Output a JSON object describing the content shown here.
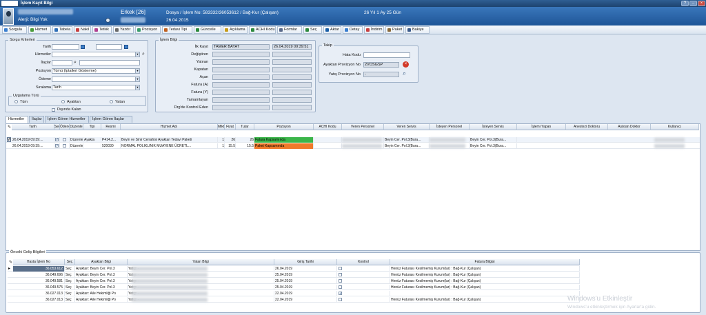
{
  "window": {
    "title": "İşlem Kayıt Bilgi"
  },
  "header": {
    "gender_age": "Erkek [26]",
    "dossier": "Dosya / İşlem No: 583332/36053612 / Bağ-Kur (Çalışan)",
    "duration": "26 Yıl 1 Ay 25 Gün",
    "allergy": "Alerji: Bilgi Yok",
    "date": "26.04.2015"
  },
  "toolbar": [
    {
      "label": "Sorgula",
      "icon": "search-icon",
      "color": "#3a7fd0"
    },
    {
      "label": "Hizmet",
      "icon": "service-icon",
      "color": "#4a9c3a"
    },
    {
      "label": "Tabela",
      "icon": "table-icon",
      "color": "#2f6fb8"
    },
    {
      "label": "Nakil",
      "icon": "transfer-icon",
      "color": "#c84040"
    },
    {
      "label": "Tetkik",
      "icon": "test-icon",
      "color": "#b04090"
    },
    {
      "label": "Yazdır",
      "icon": "print-icon",
      "color": "#6a6a6a"
    },
    {
      "label": "Pozisyon",
      "icon": "position-icon",
      "color": "#3a9c6a"
    },
    {
      "label": "Tedavi Tipi",
      "icon": "treatment-icon",
      "color": "#c06020"
    },
    {
      "label": "Güncelle",
      "icon": "refresh-icon",
      "color": "#2d8a3e"
    },
    {
      "label": "Açıklama",
      "icon": "note-icon",
      "color": "#c79b1a"
    },
    {
      "label": "ACHI Kodu",
      "icon": "code-icon",
      "color": "#2d8a3e"
    },
    {
      "label": "Formlar",
      "icon": "form-icon",
      "color": "#5a6a8a"
    },
    {
      "label": "Seç",
      "icon": "select-icon",
      "color": "#2d8a3e"
    },
    {
      "label": "Aktar",
      "icon": "export-icon",
      "color": "#1a5fa8"
    },
    {
      "label": "Detay",
      "icon": "detail-icon",
      "color": "#3a7fd0"
    },
    {
      "label": "İndirim",
      "icon": "discount-icon",
      "color": "#c84040"
    },
    {
      "label": "Paket",
      "icon": "package-icon",
      "color": "#8a6a3a"
    },
    {
      "label": "Bakiye",
      "icon": "balance-icon",
      "color": "#3a5a8a"
    }
  ],
  "query": {
    "title": "Sorgu Kriterleri",
    "tarih": "Tarih",
    "hizmetler": "Hizmetler",
    "ilaclar": "İlaçlar",
    "pozisyon": "Pozisyon",
    "pozisyon_value": "Tümü (İptalleri Gösterme)",
    "odeme": "Ödeme",
    "siralama": "Sıralama",
    "siralama_value": "Tarih",
    "treatment_type": "Uygulama Türü",
    "r_all": "Tüm",
    "r_out": "Ayaktan",
    "r_in": "Yatan",
    "excluded": "Dışında Kalan"
  },
  "operation": {
    "title": "İşlem Bilgi",
    "ilk_kayit": "İlk Kayıt",
    "ilk_kayit_user": "TAMER BAYAT",
    "ilk_kayit_date": "26.04.2019 09:39:51",
    "degistiren": "Değiştiren",
    "yatiran": "Yatıran",
    "kapatan": "Kapatan",
    "acan": "Açan",
    "fatura_a": "Fatura (A)",
    "fatura_y": "Fatura (Y)",
    "tamamlayan": "Tamamlayan",
    "drg": "Drg'de Kontrol Eden"
  },
  "takip": {
    "title": "Takip",
    "hata_kodu": "Hata Kodu",
    "ayaktan": "Ayaktan Provizyon No",
    "ayaktan_value": "2VOSGSP",
    "yatis": "Yatış Provizyon No",
    "yatis_value": "-"
  },
  "tabs": [
    "Hizmetler",
    "İlaçlar",
    "İşlem Gören Hizmetler",
    "İşlem Gören İlaçlar"
  ],
  "services": {
    "columns": [
      "Tarih",
      "Seç",
      "Ödenen",
      "Düzenle",
      "Tipi",
      "Resmi",
      "Hizmet Adı",
      "Miktar",
      "Fiyat",
      "Tutar",
      "Pozisyon",
      "ACHI Kodu",
      "Veren Personel",
      "Veren Servis",
      "İsteyen Personel",
      "İsteyen Servis",
      "İşlemi Yapan",
      "Anestezi Doktoru",
      "Asistan Doktor",
      "Kullanıcı"
    ],
    "rows": [
      {
        "marker": "W",
        "tarih": "26.04.2019 09:39:...",
        "sec": "✓",
        "duzenle": "Düzenle",
        "tipi": "Ayakta",
        "resmi": "P414.2...",
        "hizmet": "Beyin ve Sinir Cerrahisi Ayaktan Tedavi Paketi",
        "miktar": "1",
        "fiyat": "26",
        "tutar": "26",
        "pozisyon": "Fatura Kapsamında",
        "pos_color": "#3bb54a",
        "veren_servis": "Beyin Cer. Pol.3(Bura...",
        "isteyen_servis": "Beyin Cer. Pol.3(Bura..."
      },
      {
        "marker": "",
        "tarih": "26.04.2019 09:39:...",
        "sec": "✓",
        "duzenle": "Düzenle",
        "tipi": "",
        "resmi": "520030",
        "hizmet": "NORMAL POLIKLINIK MUAYENE ÜCRETL...",
        "miktar": "1",
        "fiyat": "15.5",
        "tutar": "15.5",
        "pozisyon": "Paket Kapsamında",
        "pos_color": "#f07a2a",
        "veren_servis": "Beyin Cer. Pol.3(Bura...",
        "isteyen_servis": "Beyin Cer. Pol.3(Bura..."
      }
    ]
  },
  "previous": {
    "title": "Önceki Geliş Bilgileri",
    "columns": [
      "Hasta İşlem No",
      "Seç",
      "Ayaktan Bilgi",
      "Yatan Bilgi",
      "Giriş Tarihi",
      "Kontrol",
      "Fatura Bilgisi"
    ],
    "rows": [
      {
        "no": "36.053.612",
        "sec": "Seç",
        "ayaktan": "Ayaktan: Beyin Cer. Pol.3",
        "yatan": "Yatış: -",
        "tarih": "26.04.2019",
        "kontrol": "",
        "fatura": "Henüz Faturası Kesilmemiş Kurum(lar) : Bağ-Kur (Çalışan)"
      },
      {
        "no": "36.049.696",
        "sec": "Seç",
        "ayaktan": "Ayaktan: Beyin Cer. Pol.3",
        "yatan": "Yatış: -",
        "tarih": "25.04.2019",
        "kontrol": "",
        "fatura": "Henüz Faturası Kesilmemiş Kurum(lar) : Bağ-Kur (Çalışan)"
      },
      {
        "no": "36.049.581",
        "sec": "Seç",
        "ayaktan": "Ayaktan: Beyin Cer. Pol.3",
        "yatan": "Yatış: -",
        "tarih": "25.04.2019",
        "kontrol": "",
        "fatura": "Henüz Faturası Kesilmemiş Kurum(lar) : Bağ-Kur (Çalışan)"
      },
      {
        "no": "36.049.575",
        "sec": "Seç",
        "ayaktan": "Ayaktan: Beyin Cer. Pol.3",
        "yatan": "Yatış: -",
        "tarih": "25.04.2019",
        "kontrol": "",
        "fatura": "Henüz Faturası Kesilmemiş Kurum(lar) : Bağ-Kur (Çalışan)"
      },
      {
        "no": "36.027.013",
        "sec": "Seç",
        "ayaktan": "Ayaktan: Aile Hekimliği Po",
        "yatan": "Yatış: -",
        "tarih": "22.04.2019",
        "kontrol": "✓",
        "fatura": ""
      },
      {
        "no": "36.027.013",
        "sec": "Seç",
        "ayaktan": "Ayaktan: Aile Hekimliği Po",
        "yatan": "Yatış: -",
        "tarih": "22.04.2019",
        "kontrol": "",
        "fatura": "Henüz Faturası Kesilmemiş Kurum(lar) : Bağ-Kur (Çalışan)"
      }
    ]
  },
  "watermark": {
    "line1": "Windows'u Etkinleştir",
    "line2": "Windows'u etkinleştirmek için Ayarlar'a gidin."
  }
}
